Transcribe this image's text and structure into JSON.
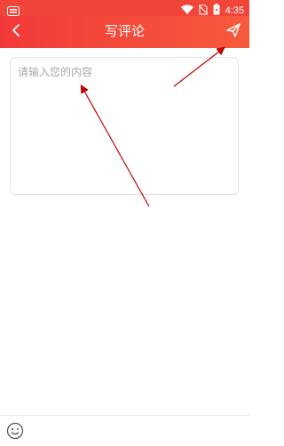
{
  "status_bar": {
    "time": "4:35",
    "icons": [
      "notification-icon",
      "wifi-icon",
      "no-sim-icon",
      "battery-icon"
    ]
  },
  "header": {
    "title": "写评论",
    "back_icon": "chevron-left-icon",
    "send_icon": "send-icon"
  },
  "editor": {
    "placeholder": "请输入您的内容",
    "value": ""
  },
  "bottom_bar": {
    "emoji_icon": "emoji-icon"
  },
  "colors": {
    "header_start": "#f23a3a",
    "header_end": "#f65a3b",
    "annotation_arrow": "#c00000"
  }
}
